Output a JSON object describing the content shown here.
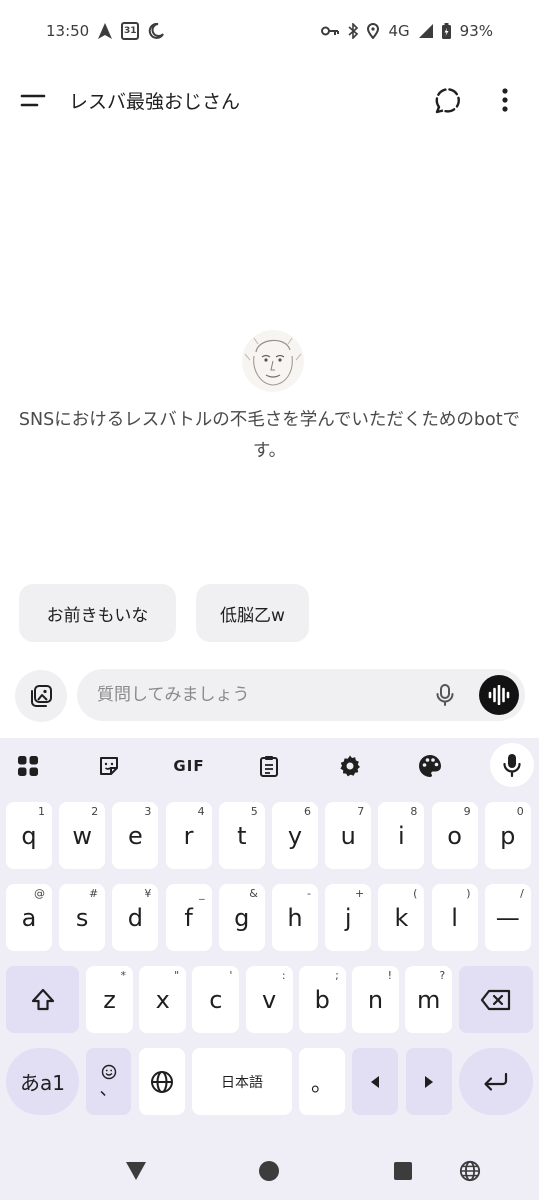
{
  "status_bar": {
    "time": "13:50",
    "calendar_day": "31",
    "network": "4G",
    "battery": "93%",
    "icons": [
      "navigation-arrow-icon",
      "calendar-icon",
      "moon-icon",
      "key-icon",
      "bluetooth-icon",
      "location-icon",
      "signal-icon",
      "battery-icon"
    ]
  },
  "app_bar": {
    "title": "レスバ最強おじさん",
    "icons": [
      "menu-icon",
      "new-chat-icon",
      "more-vert-icon"
    ]
  },
  "bot": {
    "description": "SNSにおけるレスバトルの不毛さを学んでいただくためのbotです。"
  },
  "suggestions": [
    "お前きもいな",
    "低脳乙w"
  ],
  "input": {
    "placeholder": "質問してみましょう",
    "value": ""
  },
  "keyboard": {
    "toolbar": [
      "apps-icon",
      "sticker-icon",
      "GIF",
      "clipboard-icon",
      "settings-icon",
      "palette-icon",
      "mic-icon"
    ],
    "gif_label": "GIF",
    "row1": [
      {
        "key": "q",
        "hint": "1"
      },
      {
        "key": "w",
        "hint": "2"
      },
      {
        "key": "e",
        "hint": "3"
      },
      {
        "key": "r",
        "hint": "4"
      },
      {
        "key": "t",
        "hint": "5"
      },
      {
        "key": "y",
        "hint": "6"
      },
      {
        "key": "u",
        "hint": "7"
      },
      {
        "key": "i",
        "hint": "8"
      },
      {
        "key": "o",
        "hint": "9"
      },
      {
        "key": "p",
        "hint": "0"
      }
    ],
    "row2": [
      {
        "key": "a",
        "hint": "@"
      },
      {
        "key": "s",
        "hint": "#"
      },
      {
        "key": "d",
        "hint": "¥"
      },
      {
        "key": "f",
        "hint": "_"
      },
      {
        "key": "g",
        "hint": "&"
      },
      {
        "key": "h",
        "hint": "-"
      },
      {
        "key": "j",
        "hint": "+"
      },
      {
        "key": "k",
        "hint": "("
      },
      {
        "key": "l",
        "hint": ")"
      },
      {
        "key": "—",
        "hint": "/"
      }
    ],
    "row3": [
      {
        "key": "z",
        "hint": "*"
      },
      {
        "key": "x",
        "hint": "\""
      },
      {
        "key": "c",
        "hint": "'"
      },
      {
        "key": "v",
        "hint": ":"
      },
      {
        "key": "b",
        "hint": ";"
      },
      {
        "key": "n",
        "hint": "!"
      },
      {
        "key": "m",
        "hint": "?"
      }
    ],
    "mode_key": "あa1",
    "emoji_key_sub": "、",
    "space_label": "日本語",
    "period_key": "。",
    "accent_color": "#e2def4"
  },
  "nav_bar": {
    "icons": [
      "back-icon",
      "home-icon",
      "recents-icon",
      "globe-icon"
    ]
  }
}
